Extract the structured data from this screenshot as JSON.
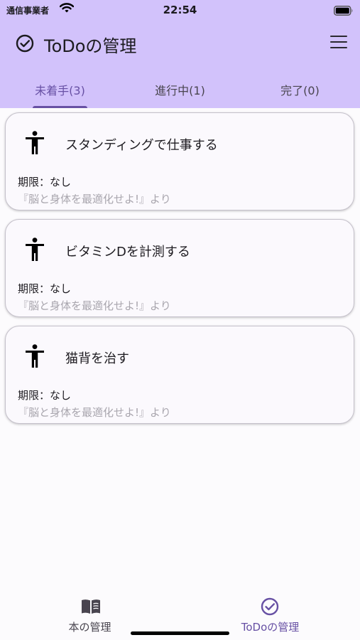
{
  "status_bar": {
    "carrier": "通信事業者",
    "time": "22:54"
  },
  "app_bar": {
    "title": "ToDoの管理",
    "title_icon": "check-circle-icon",
    "menu_icon": "hamburger-menu-icon"
  },
  "tabs": [
    {
      "label": "未着手(3)",
      "active": true
    },
    {
      "label": "進行中(1)",
      "active": false
    },
    {
      "label": "完了(0)",
      "active": false
    }
  ],
  "todos": [
    {
      "title": "スタンディングで仕事する",
      "deadline": "期限：なし",
      "source": "『脳と身体を最適化せよ!』より",
      "icon": "accessibility-person-icon"
    },
    {
      "title": "ビタミンDを計測する",
      "deadline": "期限：なし",
      "source": "『脳と身体を最適化せよ!』より",
      "icon": "accessibility-person-icon"
    },
    {
      "title": "猫背を治す",
      "deadline": "期限：なし",
      "source": "『脳と身体を最適化せよ!』より",
      "icon": "accessibility-person-icon"
    }
  ],
  "bottom_nav": [
    {
      "label": "本の管理",
      "icon": "book-icon",
      "active": false
    },
    {
      "label": "ToDoの管理",
      "icon": "check-circle-icon",
      "active": true
    }
  ],
  "colors": {
    "header_bg": "#d2c2fb",
    "accent": "#6750a4",
    "background": "#fcfbfd",
    "muted_text": "#a9a6ae"
  }
}
